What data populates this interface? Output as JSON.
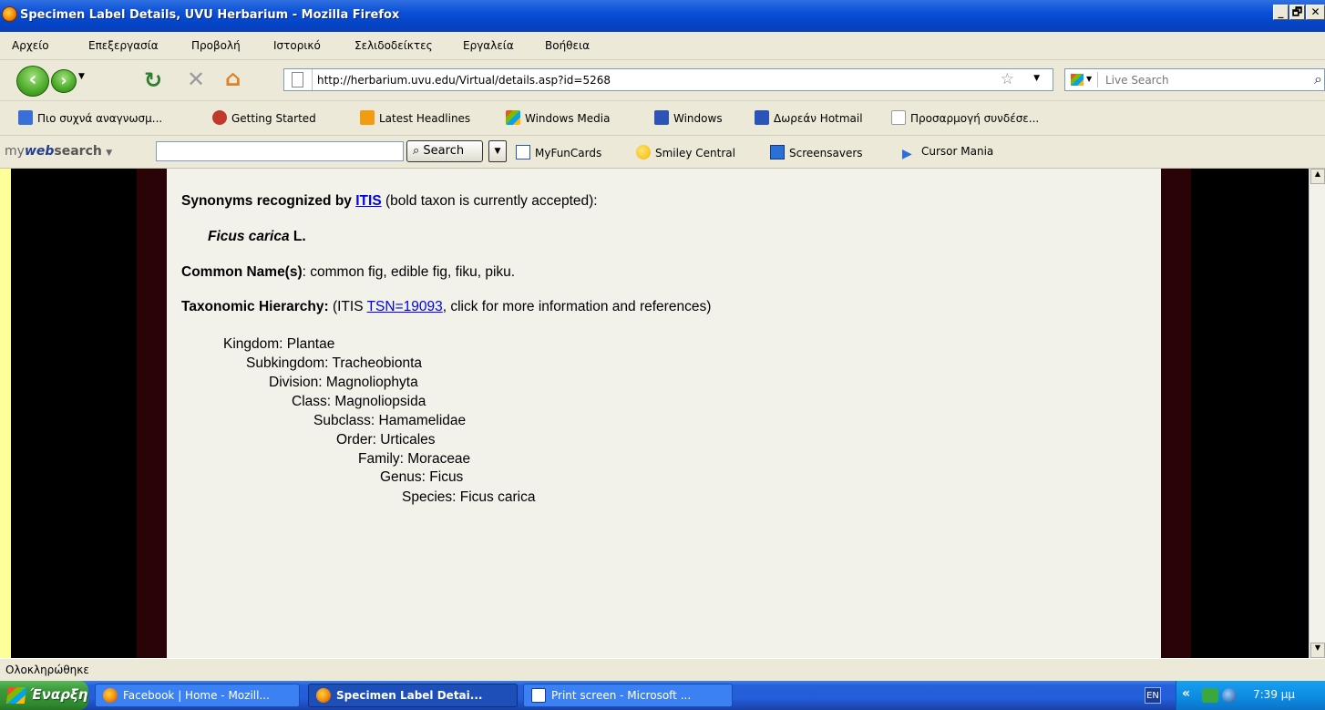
{
  "window": {
    "title": "Specimen Label Details, UVU Herbarium - Mozilla Firefox",
    "controls": [
      "_",
      "🗗",
      "✕"
    ]
  },
  "menu": [
    "Αρχείο",
    "Επεξεργασία",
    "Προβολή",
    "Ιστορικό",
    "Σελιδοδείκτες",
    "Εργαλεία",
    "Βοήθεια"
  ],
  "nav": {
    "url": "http://herbarium.uvu.edu/Virtual/details.asp?id=5268",
    "search_placeholder": "Live Search"
  },
  "bookmarks": [
    {
      "label": "Πιο συχνά αναγνωσμ...",
      "icon": "most-visited-icon",
      "color": "#3a6fd8"
    },
    {
      "label": "Getting Started",
      "icon": "firefox-getting-started-icon",
      "color": "#c0392b"
    },
    {
      "label": "Latest Headlines",
      "icon": "rss-feed-icon",
      "color": "#f39c12"
    },
    {
      "label": "Windows Media",
      "icon": "windows-media-icon",
      "color": "#3a8ad8"
    },
    {
      "label": "Windows",
      "icon": "msn-icon",
      "color": "#2b53b8"
    },
    {
      "label": "Δωρεάν Hotmail",
      "icon": "msn-icon",
      "color": "#2b53b8"
    },
    {
      "label": "Προσαρμογή συνδέσε...",
      "icon": "page-icon",
      "color": "#ffffff"
    }
  ],
  "websearch": {
    "brand_prefix": "my",
    "brand_mid": "web",
    "brand_suffix": "search",
    "search_button": "Search",
    "links": [
      {
        "label": "MyFunCards",
        "icon": "ecard-icon"
      },
      {
        "label": "Smiley Central",
        "icon": "smiley-icon"
      },
      {
        "label": "Screensavers",
        "icon": "monitor-icon"
      },
      {
        "label": "Cursor Mania",
        "icon": "cursor-icon"
      }
    ]
  },
  "content": {
    "synonyms_label": "Synonyms recognized by",
    "itis_link": "ITIS",
    "synonyms_note": "(bold taxon is currently accepted):",
    "accepted_genus_species": "Ficus carica",
    "accepted_author": "L.",
    "common_names_label": "Common Name(s)",
    "common_names_value": ": common fig, edible fig, fiku, piku.",
    "hierarchy_label": "Taxonomic Hierarchy:",
    "hierarchy_prefix": "(ITIS",
    "tsn_link": "TSN=19093",
    "hierarchy_suffix": ", click for more information and references)",
    "hierarchy": [
      "Kingdom: Plantae",
      "Subkingdom: Tracheobionta",
      "Division: Magnoliophyta",
      "Class: Magnoliopsida",
      "Subclass: Hamamelidae",
      "Order: Urticales",
      "Family: Moraceae",
      "Genus: Ficus",
      "Species: Ficus carica"
    ]
  },
  "status": "Ολοκληρώθηκε",
  "taskbar": {
    "start": "Έναρξη",
    "tasks": [
      {
        "label": "Facebook | Home - Mozill...",
        "active": false,
        "icon": "firefox-icon"
      },
      {
        "label": "Specimen Label Detai...",
        "active": true,
        "icon": "firefox-icon"
      },
      {
        "label": "Print screen - Microsoft ...",
        "active": false,
        "icon": "word-icon"
      }
    ],
    "lang": "EN",
    "chevron": "«",
    "clock": "7:39 μμ"
  }
}
